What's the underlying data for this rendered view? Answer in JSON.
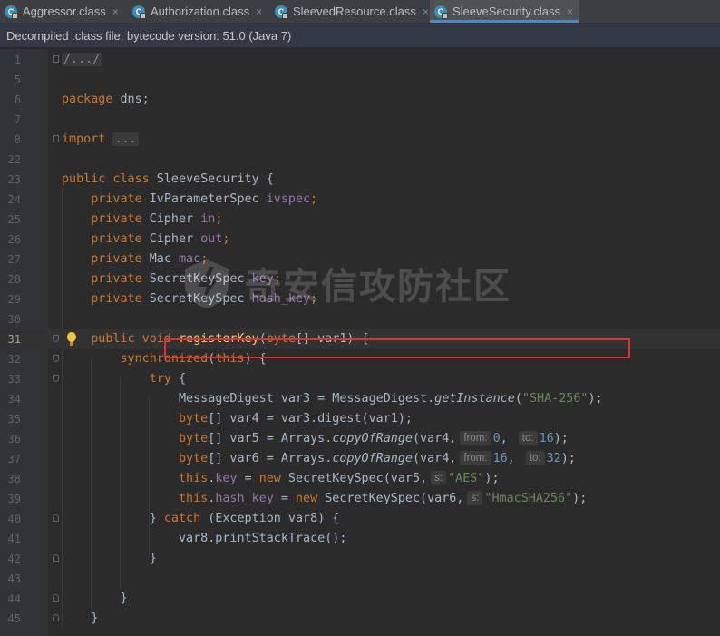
{
  "tabs": [
    {
      "label": "Aggressor.class",
      "icon": "class-file-icon",
      "active": false
    },
    {
      "label": "Authorization.class",
      "icon": "class-file-icon",
      "active": false
    },
    {
      "label": "SleevedResource.class",
      "icon": "class-file-icon",
      "active": false
    },
    {
      "label": "SleeveSecurity.class",
      "icon": "class-file-icon",
      "active": true
    }
  ],
  "tab_icon_letter": "C",
  "tab_close_glyph": "×",
  "banner": {
    "text": "Decompiled .class file, bytecode version: 51.0 (Java 7)"
  },
  "watermark": {
    "text": "奇安信攻防社区"
  },
  "editor": {
    "current_line": "31",
    "highlighted_line": "34",
    "lines": [
      {
        "n": "1",
        "fold": "box",
        "tokens": [
          {
            "t": "/.../",
            "c": "folded"
          }
        ]
      },
      {
        "n": "5",
        "tokens": []
      },
      {
        "n": "6",
        "tokens": [
          {
            "t": "package",
            "c": "kw"
          },
          {
            "t": " dns;",
            "c": ""
          }
        ]
      },
      {
        "n": "7",
        "tokens": []
      },
      {
        "n": "8",
        "fold": "box",
        "tokens": [
          {
            "t": "import",
            "c": "kw"
          },
          {
            "t": " ",
            "c": ""
          },
          {
            "t": "...",
            "c": "folded"
          }
        ]
      },
      {
        "n": "22",
        "tokens": []
      },
      {
        "n": "23",
        "tokens": [
          {
            "t": "public class",
            "c": "kw"
          },
          {
            "t": " SleeveSecurity {",
            "c": ""
          }
        ]
      },
      {
        "n": "24",
        "tokens": [
          {
            "t": "    private",
            "c": "kw"
          },
          {
            "t": " IvParameterSpec ",
            "c": ""
          },
          {
            "t": "ivspec",
            "c": "fld"
          },
          {
            "t": ";",
            "c": "kw"
          }
        ]
      },
      {
        "n": "25",
        "tokens": [
          {
            "t": "    private",
            "c": "kw"
          },
          {
            "t": " Cipher ",
            "c": ""
          },
          {
            "t": "in",
            "c": "fld"
          },
          {
            "t": ";",
            "c": "kw"
          }
        ]
      },
      {
        "n": "26",
        "tokens": [
          {
            "t": "    private",
            "c": "kw"
          },
          {
            "t": " Cipher ",
            "c": ""
          },
          {
            "t": "out",
            "c": "fld"
          },
          {
            "t": ";",
            "c": "kw"
          }
        ]
      },
      {
        "n": "27",
        "tokens": [
          {
            "t": "    private",
            "c": "kw"
          },
          {
            "t": " Mac ",
            "c": ""
          },
          {
            "t": "mac",
            "c": "fld"
          },
          {
            "t": ";",
            "c": "kw"
          }
        ]
      },
      {
        "n": "28",
        "tokens": [
          {
            "t": "    private",
            "c": "kw"
          },
          {
            "t": " SecretKeySpec ",
            "c": ""
          },
          {
            "t": "key",
            "c": "fld"
          },
          {
            "t": ";",
            "c": "kw"
          }
        ]
      },
      {
        "n": "29",
        "tokens": [
          {
            "t": "    private",
            "c": "kw"
          },
          {
            "t": " SecretKeySpec ",
            "c": ""
          },
          {
            "t": "hash_key",
            "c": "fld"
          },
          {
            "t": ";",
            "c": "kw"
          }
        ]
      },
      {
        "n": "30",
        "tokens": []
      },
      {
        "n": "31",
        "fold": "top",
        "bulb": true,
        "tokens": [
          {
            "t": "    public void",
            "c": "kw"
          },
          {
            "t": " ",
            "c": ""
          },
          {
            "t": "registerKey",
            "c": "mtd"
          },
          {
            "t": "(",
            "c": ""
          },
          {
            "t": "byte",
            "c": "kw"
          },
          {
            "t": "[] var1) {",
            "c": ""
          }
        ]
      },
      {
        "n": "32",
        "fold": "top",
        "tokens": [
          {
            "t": "        synchronized",
            "c": "kw"
          },
          {
            "t": "(",
            "c": ""
          },
          {
            "t": "this",
            "c": "kw"
          },
          {
            "t": ") {",
            "c": ""
          }
        ]
      },
      {
        "n": "33",
        "fold": "top",
        "tokens": [
          {
            "t": "            try",
            "c": "kw"
          },
          {
            "t": " {",
            "c": ""
          }
        ]
      },
      {
        "n": "34",
        "tokens": [
          {
            "t": "                MessageDigest var3 = MessageDigest.",
            "c": ""
          },
          {
            "t": "getInstance",
            "c": "it"
          },
          {
            "t": "(",
            "c": ""
          },
          {
            "t": "\"SHA-256\"",
            "c": "str"
          },
          {
            "t": ");",
            "c": ""
          }
        ]
      },
      {
        "n": "35",
        "tokens": [
          {
            "t": "                byte",
            "c": "kw"
          },
          {
            "t": "[] var4 = var3.digest(var1);",
            "c": ""
          }
        ]
      },
      {
        "n": "36",
        "tokens": [
          {
            "t": "                byte",
            "c": "kw"
          },
          {
            "t": "[] var5 = Arrays.",
            "c": ""
          },
          {
            "t": "copyOfRange",
            "c": "it"
          },
          {
            "t": "(var4,",
            "c": ""
          },
          {
            "t": "from:",
            "c": "hint"
          },
          {
            "t": "0",
            "c": "num"
          },
          {
            "t": ", ",
            "c": ""
          },
          {
            "t": "to:",
            "c": "hint"
          },
          {
            "t": "16",
            "c": "num"
          },
          {
            "t": ");",
            "c": ""
          }
        ]
      },
      {
        "n": "37",
        "tokens": [
          {
            "t": "                byte",
            "c": "kw"
          },
          {
            "t": "[] var6 = Arrays.",
            "c": ""
          },
          {
            "t": "copyOfRange",
            "c": "it"
          },
          {
            "t": "(var4,",
            "c": ""
          },
          {
            "t": "from:",
            "c": "hint"
          },
          {
            "t": "16",
            "c": "num"
          },
          {
            "t": ", ",
            "c": ""
          },
          {
            "t": "to:",
            "c": "hint"
          },
          {
            "t": "32",
            "c": "num"
          },
          {
            "t": ");",
            "c": ""
          }
        ]
      },
      {
        "n": "38",
        "tokens": [
          {
            "t": "                this",
            "c": "kw"
          },
          {
            "t": ".",
            "c": ""
          },
          {
            "t": "key",
            "c": "fld"
          },
          {
            "t": " = ",
            "c": ""
          },
          {
            "t": "new",
            "c": "kw"
          },
          {
            "t": " SecretKeySpec(var5,",
            "c": ""
          },
          {
            "t": "s:",
            "c": "hint"
          },
          {
            "t": "\"AES\"",
            "c": "str"
          },
          {
            "t": ");",
            "c": ""
          }
        ]
      },
      {
        "n": "39",
        "tokens": [
          {
            "t": "                this",
            "c": "kw"
          },
          {
            "t": ".",
            "c": ""
          },
          {
            "t": "hash_key",
            "c": "fld"
          },
          {
            "t": " = ",
            "c": ""
          },
          {
            "t": "new",
            "c": "kw"
          },
          {
            "t": " SecretKeySpec(var6,",
            "c": ""
          },
          {
            "t": "s:",
            "c": "hint"
          },
          {
            "t": "\"HmacSHA256\"",
            "c": "str"
          },
          {
            "t": ");",
            "c": ""
          }
        ]
      },
      {
        "n": "40",
        "fold": "bottom",
        "tokens": [
          {
            "t": "            } ",
            "c": ""
          },
          {
            "t": "catch",
            "c": "kw"
          },
          {
            "t": " (Exception var8) {",
            "c": ""
          }
        ]
      },
      {
        "n": "41",
        "tokens": [
          {
            "t": "                var8.printStackTrace();",
            "c": ""
          }
        ]
      },
      {
        "n": "42",
        "fold": "bottom",
        "tokens": [
          {
            "t": "            }",
            "c": ""
          }
        ]
      },
      {
        "n": "43",
        "tokens": []
      },
      {
        "n": "44",
        "fold": "bottom",
        "tokens": [
          {
            "t": "        }",
            "c": ""
          }
        ]
      },
      {
        "n": "45",
        "fold": "bottom",
        "tokens": [
          {
            "t": "    }",
            "c": ""
          }
        ]
      }
    ]
  }
}
